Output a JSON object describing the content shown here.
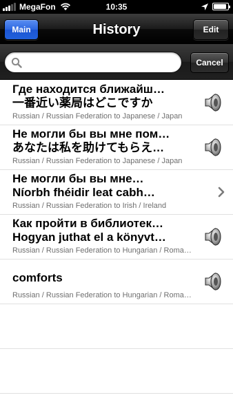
{
  "status": {
    "carrier": "MegaFon",
    "time": "10:35",
    "battery_level": 0.92
  },
  "nav": {
    "left_button": "Main",
    "title": "History",
    "right_button": "Edit"
  },
  "search": {
    "value": "",
    "placeholder": "",
    "cancel_label": "Cancel"
  },
  "rows": [
    {
      "line1": "Где находится ближайш…",
      "line2": "一番近い薬局はどこですか",
      "sub": "Russian / Russian Federation to Japanese / Japan",
      "accessory": "speaker-icon"
    },
    {
      "line1": "Не могли бы вы мне пом…",
      "line2": "あなたは私を助けてもらえ…",
      "sub": "Russian / Russian Federation to Japanese / Japan",
      "accessory": "speaker-icon"
    },
    {
      "line1": "Не могли бы вы мне…",
      "line2": "Níorbh fhéidir leat cabh…",
      "sub": "Russian / Russian Federation to Irish / Ireland",
      "accessory": "chevron-right-icon"
    },
    {
      "line1": "Как пройти в библиотек…",
      "line2": "Hogyan juthat el a könyvt…",
      "sub": "Russian / Russian Federation to Hungarian / Roma…",
      "accessory": "speaker-icon"
    },
    {
      "line1": "comforts",
      "line2": "",
      "sub": "Russian / Russian Federation to Hungarian / Roma…",
      "accessory": "speaker-icon"
    }
  ],
  "colors": {
    "main_button": "#2c66e0",
    "nav_bar": "#1b1b1b",
    "subtitle_text": "#6f6f6f"
  }
}
